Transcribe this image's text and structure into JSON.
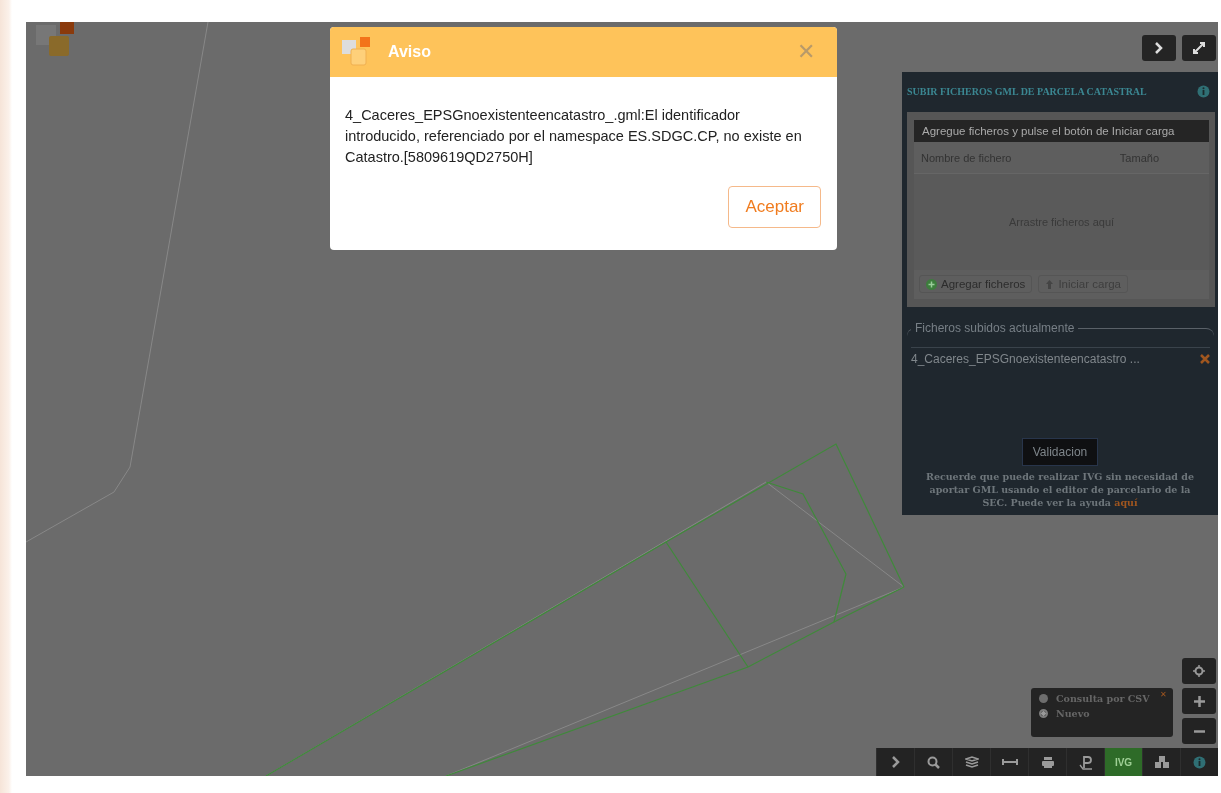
{
  "dialog": {
    "title": "Aviso",
    "close": "✕",
    "message": "4_Caceres_EPSGnoexistenteencatastro_.gml:El identificador introducido, referenciado por el namespace ES.SDGC.CP, no existe en Catastro.[5809619QD2750H]",
    "button": "Aceptar"
  },
  "panel": {
    "title": "SUBIR FICHEROS GML DE PARCELA CATASTRAL",
    "upload_box": {
      "header": "Agregue ficheros y pulse el botón de Iniciar carga",
      "columns": [
        "Nombre de fichero",
        "Tamaño"
      ],
      "drop_hint": "Arrastre ficheros aquí",
      "buttons": [
        {
          "label": "Agregar ficheros",
          "kind": "add",
          "disabled": false
        },
        {
          "label": "Iniciar carga",
          "kind": "upload",
          "disabled": true
        }
      ]
    },
    "uploaded": {
      "legend": "Ficheros subidos actualmente",
      "files": [
        {
          "name": "4_Caceres_EPSGnoexistenteencatastro ..."
        }
      ]
    },
    "validate_button": "Validacion",
    "note": "Recuerde que puede realizar IVG sin necesidad de aportar GML usando el editor de parcelario de la SEC. Puede ver la ayuda",
    "note_link": "aquí"
  },
  "query_popup": {
    "close": "✕",
    "options": [
      {
        "label": "Consulta por CSV",
        "selected": false
      },
      {
        "label": "Nuevo",
        "selected": true
      }
    ]
  },
  "toolbar": [
    {
      "kind": "chevron",
      "selected": false
    },
    {
      "kind": "search",
      "selected": false
    },
    {
      "kind": "layers",
      "selected": false
    },
    {
      "kind": "measure",
      "selected": false
    },
    {
      "kind": "print",
      "selected": false
    },
    {
      "kind": "parcel",
      "selected": false
    },
    {
      "kind": "text",
      "label": "IVG",
      "selected": true
    },
    {
      "kind": "cubes",
      "selected": false
    },
    {
      "kind": "info",
      "selected": false
    }
  ]
}
